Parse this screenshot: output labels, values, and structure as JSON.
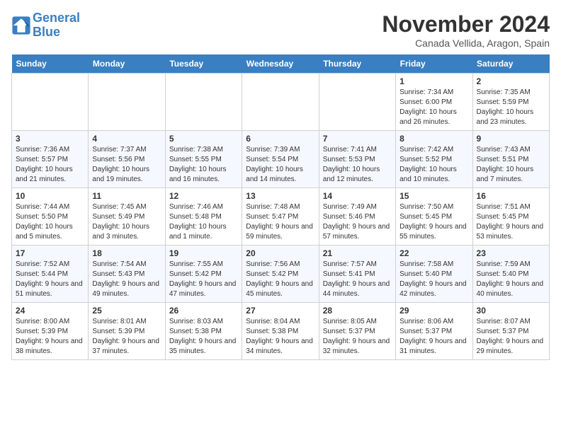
{
  "header": {
    "logo_line1": "General",
    "logo_line2": "Blue",
    "month": "November 2024",
    "location": "Canada Vellida, Aragon, Spain"
  },
  "weekdays": [
    "Sunday",
    "Monday",
    "Tuesday",
    "Wednesday",
    "Thursday",
    "Friday",
    "Saturday"
  ],
  "weeks": [
    [
      {
        "day": "",
        "detail": ""
      },
      {
        "day": "",
        "detail": ""
      },
      {
        "day": "",
        "detail": ""
      },
      {
        "day": "",
        "detail": ""
      },
      {
        "day": "",
        "detail": ""
      },
      {
        "day": "1",
        "detail": "Sunrise: 7:34 AM\nSunset: 6:00 PM\nDaylight: 10 hours and 26 minutes."
      },
      {
        "day": "2",
        "detail": "Sunrise: 7:35 AM\nSunset: 5:59 PM\nDaylight: 10 hours and 23 minutes."
      }
    ],
    [
      {
        "day": "3",
        "detail": "Sunrise: 7:36 AM\nSunset: 5:57 PM\nDaylight: 10 hours and 21 minutes."
      },
      {
        "day": "4",
        "detail": "Sunrise: 7:37 AM\nSunset: 5:56 PM\nDaylight: 10 hours and 19 minutes."
      },
      {
        "day": "5",
        "detail": "Sunrise: 7:38 AM\nSunset: 5:55 PM\nDaylight: 10 hours and 16 minutes."
      },
      {
        "day": "6",
        "detail": "Sunrise: 7:39 AM\nSunset: 5:54 PM\nDaylight: 10 hours and 14 minutes."
      },
      {
        "day": "7",
        "detail": "Sunrise: 7:41 AM\nSunset: 5:53 PM\nDaylight: 10 hours and 12 minutes."
      },
      {
        "day": "8",
        "detail": "Sunrise: 7:42 AM\nSunset: 5:52 PM\nDaylight: 10 hours and 10 minutes."
      },
      {
        "day": "9",
        "detail": "Sunrise: 7:43 AM\nSunset: 5:51 PM\nDaylight: 10 hours and 7 minutes."
      }
    ],
    [
      {
        "day": "10",
        "detail": "Sunrise: 7:44 AM\nSunset: 5:50 PM\nDaylight: 10 hours and 5 minutes."
      },
      {
        "day": "11",
        "detail": "Sunrise: 7:45 AM\nSunset: 5:49 PM\nDaylight: 10 hours and 3 minutes."
      },
      {
        "day": "12",
        "detail": "Sunrise: 7:46 AM\nSunset: 5:48 PM\nDaylight: 10 hours and 1 minute."
      },
      {
        "day": "13",
        "detail": "Sunrise: 7:48 AM\nSunset: 5:47 PM\nDaylight: 9 hours and 59 minutes."
      },
      {
        "day": "14",
        "detail": "Sunrise: 7:49 AM\nSunset: 5:46 PM\nDaylight: 9 hours and 57 minutes."
      },
      {
        "day": "15",
        "detail": "Sunrise: 7:50 AM\nSunset: 5:45 PM\nDaylight: 9 hours and 55 minutes."
      },
      {
        "day": "16",
        "detail": "Sunrise: 7:51 AM\nSunset: 5:45 PM\nDaylight: 9 hours and 53 minutes."
      }
    ],
    [
      {
        "day": "17",
        "detail": "Sunrise: 7:52 AM\nSunset: 5:44 PM\nDaylight: 9 hours and 51 minutes."
      },
      {
        "day": "18",
        "detail": "Sunrise: 7:54 AM\nSunset: 5:43 PM\nDaylight: 9 hours and 49 minutes."
      },
      {
        "day": "19",
        "detail": "Sunrise: 7:55 AM\nSunset: 5:42 PM\nDaylight: 9 hours and 47 minutes."
      },
      {
        "day": "20",
        "detail": "Sunrise: 7:56 AM\nSunset: 5:42 PM\nDaylight: 9 hours and 45 minutes."
      },
      {
        "day": "21",
        "detail": "Sunrise: 7:57 AM\nSunset: 5:41 PM\nDaylight: 9 hours and 44 minutes."
      },
      {
        "day": "22",
        "detail": "Sunrise: 7:58 AM\nSunset: 5:40 PM\nDaylight: 9 hours and 42 minutes."
      },
      {
        "day": "23",
        "detail": "Sunrise: 7:59 AM\nSunset: 5:40 PM\nDaylight: 9 hours and 40 minutes."
      }
    ],
    [
      {
        "day": "24",
        "detail": "Sunrise: 8:00 AM\nSunset: 5:39 PM\nDaylight: 9 hours and 38 minutes."
      },
      {
        "day": "25",
        "detail": "Sunrise: 8:01 AM\nSunset: 5:39 PM\nDaylight: 9 hours and 37 minutes."
      },
      {
        "day": "26",
        "detail": "Sunrise: 8:03 AM\nSunset: 5:38 PM\nDaylight: 9 hours and 35 minutes."
      },
      {
        "day": "27",
        "detail": "Sunrise: 8:04 AM\nSunset: 5:38 PM\nDaylight: 9 hours and 34 minutes."
      },
      {
        "day": "28",
        "detail": "Sunrise: 8:05 AM\nSunset: 5:37 PM\nDaylight: 9 hours and 32 minutes."
      },
      {
        "day": "29",
        "detail": "Sunrise: 8:06 AM\nSunset: 5:37 PM\nDaylight: 9 hours and 31 minutes."
      },
      {
        "day": "30",
        "detail": "Sunrise: 8:07 AM\nSunset: 5:37 PM\nDaylight: 9 hours and 29 minutes."
      }
    ]
  ]
}
